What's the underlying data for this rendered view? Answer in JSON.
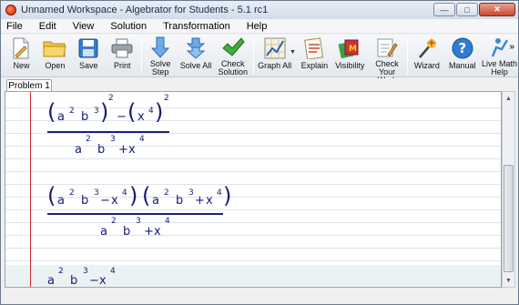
{
  "window": {
    "title": "Unnamed Workspace - Algebrator for Students - 5.1 rc1",
    "controls": {
      "minimize": "—",
      "maximize": "□",
      "close": "✕"
    }
  },
  "menu": [
    {
      "label": "File"
    },
    {
      "label": "Edit"
    },
    {
      "label": "View"
    },
    {
      "label": "Solution"
    },
    {
      "label": "Transformation"
    },
    {
      "label": "Help"
    }
  ],
  "toolbar": {
    "new": "New",
    "open": "Open",
    "save": "Save",
    "print": "Print",
    "solve_step": "Solve Step",
    "solve_all": "Solve All",
    "check_solution": "Check Solution",
    "graph_all": "Graph All",
    "explain": "Explain",
    "visibility": "Visibility",
    "check_your_work": "Check Your Work",
    "wizard": "Wizard",
    "manual": "Manual",
    "live_math_help": "Live Math Help",
    "more": "»"
  },
  "tabs": [
    {
      "label": "Problem 1"
    }
  ],
  "workspace": {
    "expr1": {
      "num": {
        "a": "a",
        "a_exp": "2",
        "b": "b",
        "b_exp": "3",
        "outer_exp": "2",
        "minus": "−",
        "x": "x",
        "x_exp": "4",
        "x_outer_exp": "2"
      },
      "den": {
        "a": "a",
        "a_exp": "2",
        "b": "b",
        "b_exp": "3",
        "plus": "+",
        "x": "x",
        "x_exp": "4"
      }
    },
    "expr2": {
      "num1": {
        "a": "a",
        "a_exp": "2",
        "b": "b",
        "b_exp": "3",
        "minus": "−",
        "x": "x",
        "x_exp": "4"
      },
      "num2": {
        "a": "a",
        "a_exp": "2",
        "b": "b",
        "b_exp": "3",
        "plus": "+",
        "x": "x",
        "x_exp": "4"
      },
      "den": {
        "a": "a",
        "a_exp": "2",
        "b": "b",
        "b_exp": "3",
        "plus": "+",
        "x": "x",
        "x_exp": "4"
      }
    },
    "expr3": {
      "a": "a",
      "a_exp": "2",
      "b": "b",
      "b_exp": "3",
      "minus": "−",
      "x": "x",
      "x_exp": "4"
    }
  },
  "colors": {
    "accent": "#1a237e",
    "margin": "#d03030",
    "math": "#1a1a7a"
  }
}
